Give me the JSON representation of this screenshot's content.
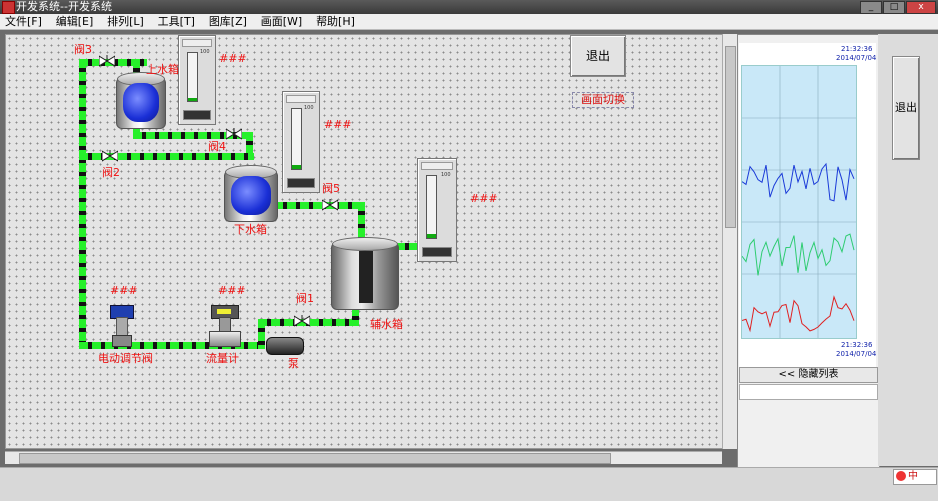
{
  "window": {
    "title": "开发系统--开发系统"
  },
  "menu": [
    "文件[F]",
    "编辑[E]",
    "排列[L]",
    "工具[T]",
    "图库[Z]",
    "画面[W]",
    "帮助[H]"
  ],
  "canvas": {
    "labels": {
      "valve3": "阀3",
      "valve4": "阀4",
      "valve2": "阀2",
      "valve5": "阀5",
      "valve1": "阀1",
      "upper_tank": "上水箱",
      "lower_tank": "下水箱",
      "aux_tank": "辅水箱",
      "electric_valve": "电动调节阀",
      "flow_meter": "流量计",
      "pump": "泵"
    },
    "placeholders": {
      "upper": "###",
      "lower": "###",
      "aux": "###",
      "electric": "###",
      "flow": "###"
    },
    "gauge_scale": [
      "100",
      "80",
      "60",
      "40",
      "20",
      "0"
    ],
    "exit_label": "退出",
    "switch_label": "画面切换",
    "gauges": [
      {
        "name": "upper",
        "level": 0.06
      },
      {
        "name": "lower",
        "level": 0.06
      },
      {
        "name": "aux",
        "level": 0.06
      }
    ]
  },
  "trend": {
    "top_time": "21:32:36",
    "top_date": "2014/07/04",
    "bottom_time": "21:32:36",
    "bottom_date": "2014/07/04",
    "hide_label": "<< 隐藏列表",
    "series_colors": [
      "#1a3ad8",
      "#2ecc71",
      "#e02020"
    ]
  },
  "right_exit_label": "退出",
  "status_icon_label": "中"
}
